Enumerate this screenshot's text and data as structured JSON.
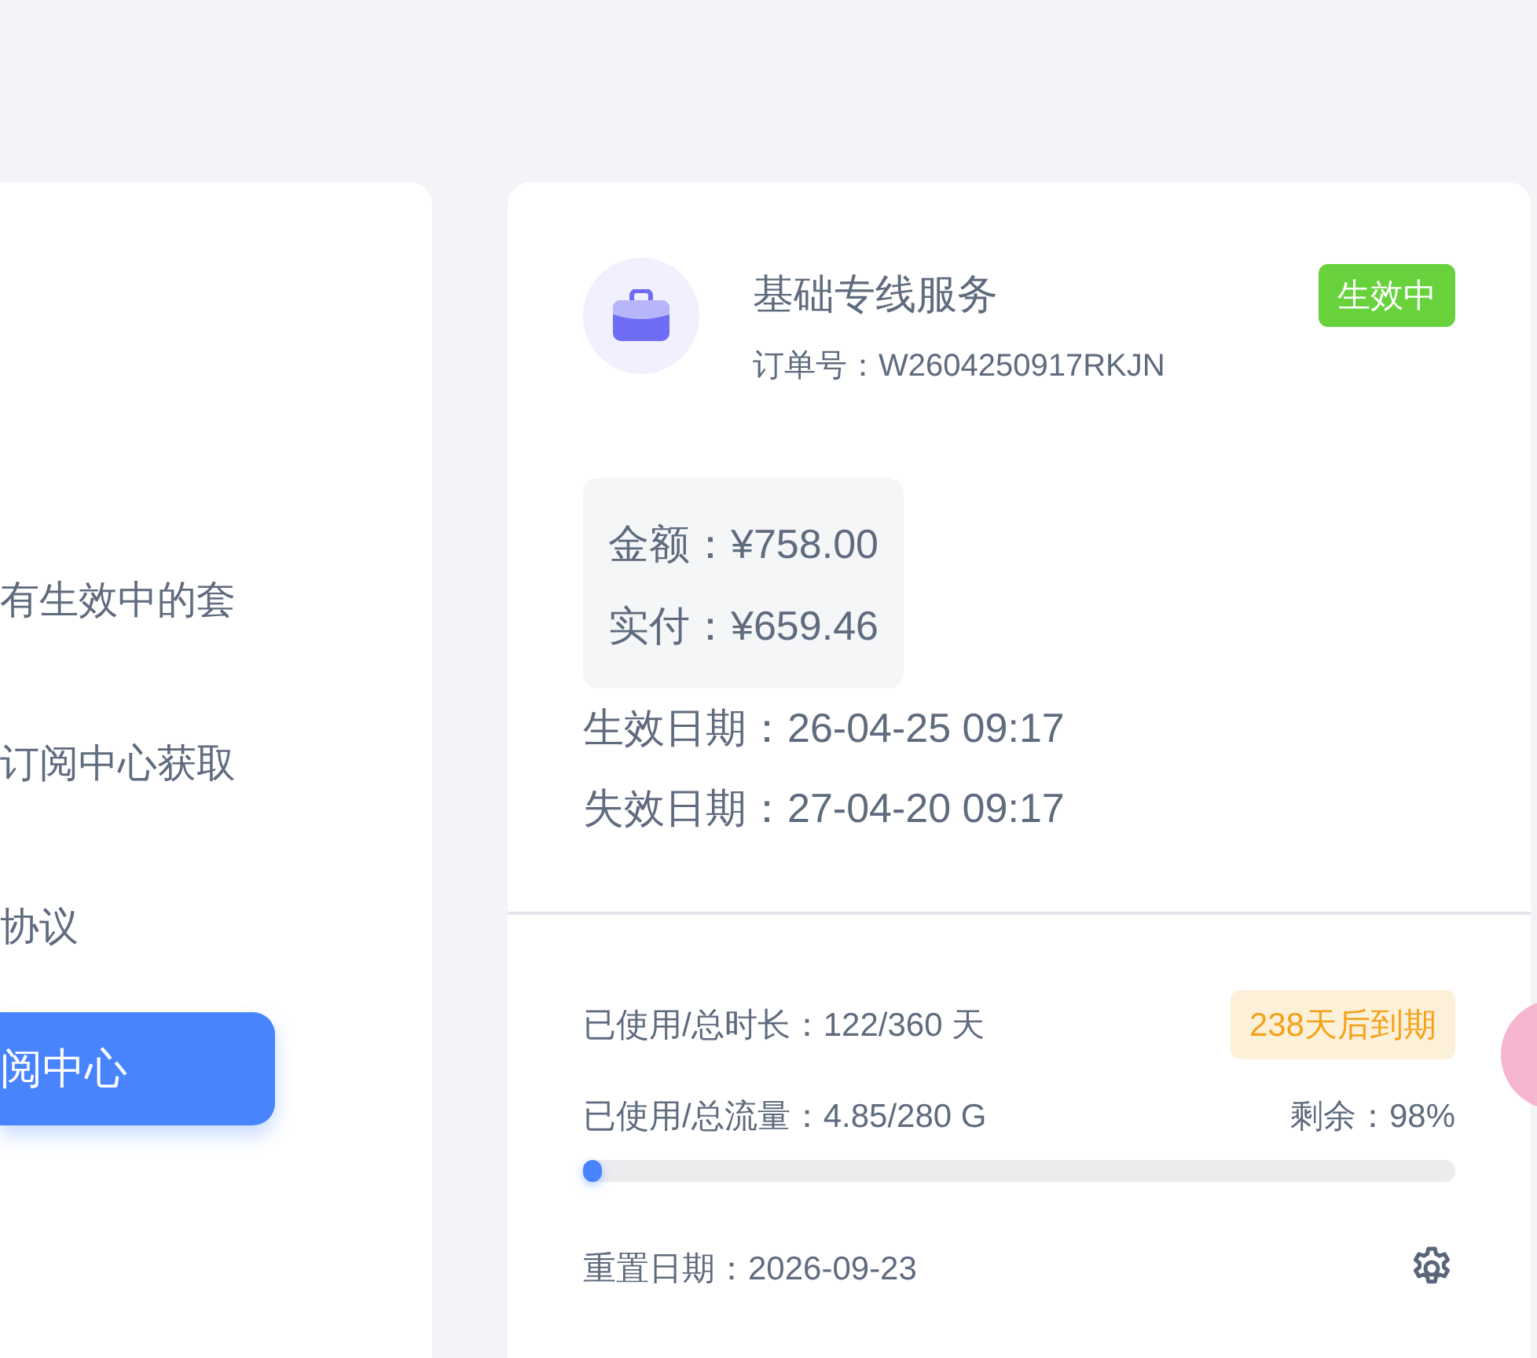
{
  "left_card": {
    "lines": [
      "有生效中的套",
      "订阅中心获取",
      "协议"
    ],
    "button": "阅中心"
  },
  "order_card": {
    "title": "基础专线服务",
    "order_no": "订单号：W2604250917RKJN",
    "status": "生效中",
    "amounts": [
      "金额：¥758.00",
      "实付：¥659.46"
    ],
    "dates": [
      "生效日期：26-04-25 09:17",
      "失效日期：27-04-20 09:17"
    ],
    "duration": "已使用/总时长：122/360 天",
    "expiry_badge": "238天后到期",
    "traffic": "已使用/总流量：4.85/280 G",
    "remaining": "剩余：98%",
    "level": 0.017,
    "reset_date": "重置日期：2026-09-23"
  }
}
